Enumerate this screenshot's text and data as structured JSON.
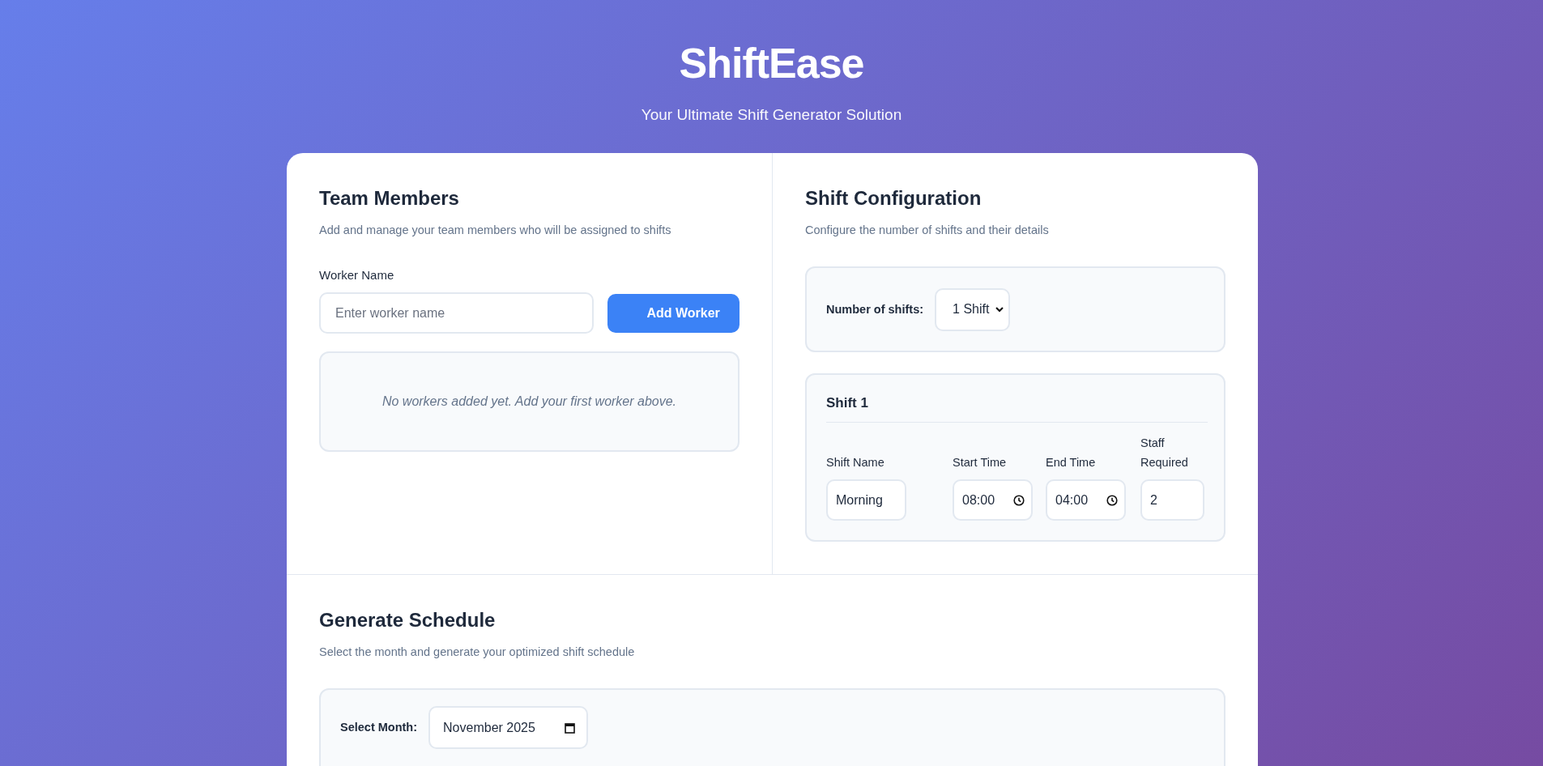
{
  "header": {
    "title": "ShiftEase",
    "subtitle": "Your Ultimate Shift Generator Solution"
  },
  "team_members": {
    "title": "Team Members",
    "description": "Add and manage your team members who will be assigned to shifts",
    "field_label": "Worker Name",
    "field": {
      "placeholder": "Enter worker name"
    },
    "add_button": "Add Worker",
    "empty_message": "No workers added yet. Add your first worker above."
  },
  "shift_configuration": {
    "title": "Shift Configuration",
    "description": "Configure the number of shifts and their details",
    "count_label": "Number of shifts:",
    "count_select": "1 Shift",
    "shifts": [
      {
        "title": "Shift 1",
        "fields": [
          {
            "kind": "text",
            "label": "Shift Name",
            "value": "Morning"
          },
          {
            "kind": "time",
            "label": "Start Time",
            "value": "08:00"
          },
          {
            "kind": "time",
            "label": "End Time",
            "value": "04:00"
          },
          {
            "kind": "number",
            "label": "Staff Required",
            "value": "2"
          }
        ]
      }
    ]
  },
  "generate_schedule": {
    "title": "Generate Schedule",
    "description": "Select the month and generate your optimized shift schedule",
    "month_label": "Select Month:",
    "month_value": "November 2025"
  }
}
